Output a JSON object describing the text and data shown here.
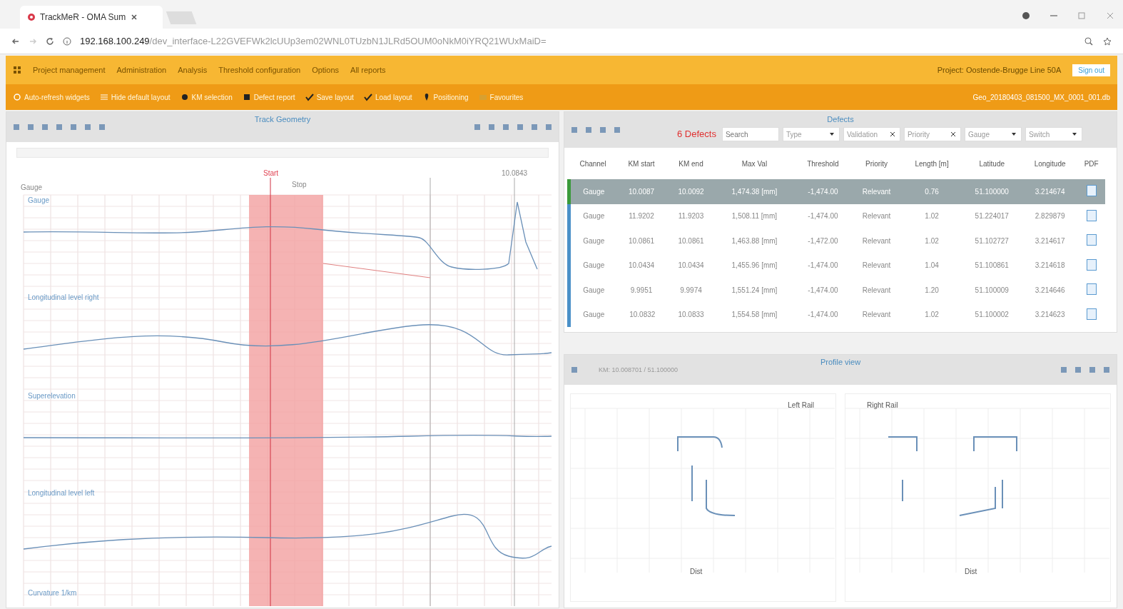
{
  "browser": {
    "tab_title": "TrackMeR - OMA Sum",
    "url_host": "192.168.100.249",
    "url_path": "/dev_interface-L22GVEFWk2lcUUp3em02WNL0TUzbN1JLRd5OUM0oNkM0iYRQ21WUxMaiD="
  },
  "menu": [
    "Project management",
    "Administration",
    "Analysis",
    "Threshold configuration",
    "Options",
    "All reports"
  ],
  "header_info": "Project: Oostende-Brugge Line 50A",
  "header_button": "Sign out",
  "toolbar": [
    {
      "kind": "refresh",
      "label": "Auto-refresh widgets"
    },
    {
      "kind": "layout",
      "label": "Hide default layout"
    },
    {
      "kind": "dot",
      "label": "KM selection"
    },
    {
      "kind": "square",
      "label": "Defect report"
    },
    {
      "kind": "check",
      "label": "Save layout"
    },
    {
      "kind": "check",
      "label": "Load layout"
    },
    {
      "kind": "pin",
      "label": "Positioning"
    },
    {
      "kind": "star",
      "label": "Favourites"
    }
  ],
  "toolbar_info": "Geo_20180403_081500_MX_0001_001.db",
  "track_geometry": {
    "title": "Track Geometry",
    "start_label": "Start",
    "stop_label": "Stop",
    "marker_label": "10.0843",
    "range_label": "Gauge",
    "channels": [
      "Gauge",
      "Longitudinal level right",
      "Superelevation",
      "Longitudinal level left",
      "Curvature 1/km"
    ]
  },
  "defects": {
    "title": "Defects",
    "count": "6 Defects",
    "filters": [
      {
        "kind": "search",
        "placeholder": "Search"
      },
      {
        "kind": "select",
        "value": "Type"
      },
      {
        "kind": "clear",
        "value": "Validation"
      },
      {
        "kind": "clear",
        "value": "Priority"
      },
      {
        "kind": "select",
        "value": "Gauge"
      },
      {
        "kind": "select",
        "value": "Switch"
      }
    ],
    "columns": [
      "Channel",
      "KM start",
      "KM end",
      "Max Val",
      "Threshold",
      "Priority",
      "Length [m]",
      "Latitude",
      "Longitude",
      "PDF"
    ],
    "rows": [
      {
        "selected": true,
        "cells": [
          "Gauge",
          "10.0087",
          "10.0092",
          "1,474.38 [mm]",
          "-1,474.00",
          "Relevant",
          "0.76",
          "51.100000",
          "3.214674"
        ]
      },
      {
        "selected": false,
        "cells": [
          "Gauge",
          "11.9202",
          "11.9203",
          "1,508.11 [mm]",
          "-1,474.00",
          "Relevant",
          "1.02",
          "51.224017",
          "2.829879"
        ]
      },
      {
        "selected": false,
        "cells": [
          "Gauge",
          "10.0861",
          "10.0861",
          "1,463.88 [mm]",
          "-1,472.00",
          "Relevant",
          "1.02",
          "51.102727",
          "3.214617"
        ]
      },
      {
        "selected": false,
        "cells": [
          "Gauge",
          "10.0434",
          "10.0434",
          "1,455.96 [mm]",
          "-1,474.00",
          "Relevant",
          "1.04",
          "51.100861",
          "3.214618"
        ]
      },
      {
        "selected": false,
        "cells": [
          "Gauge",
          "9.9951",
          "9.9974",
          "1,551.24 [mm]",
          "-1,474.00",
          "Relevant",
          "1.20",
          "51.100009",
          "3.214646"
        ]
      },
      {
        "selected": false,
        "cells": [
          "Gauge",
          "10.0832",
          "10.0833",
          "1,554.58 [mm]",
          "-1,474.00",
          "Relevant",
          "1.02",
          "51.100002",
          "3.214623"
        ]
      }
    ]
  },
  "profile": {
    "title": "Profile view",
    "subtitle": "KM: 10.008701 / 51.100000",
    "plots": [
      {
        "title": "Left Rail",
        "x_label": "Dist"
      },
      {
        "title": "Right Rail",
        "x_label": "Dist"
      }
    ]
  }
}
